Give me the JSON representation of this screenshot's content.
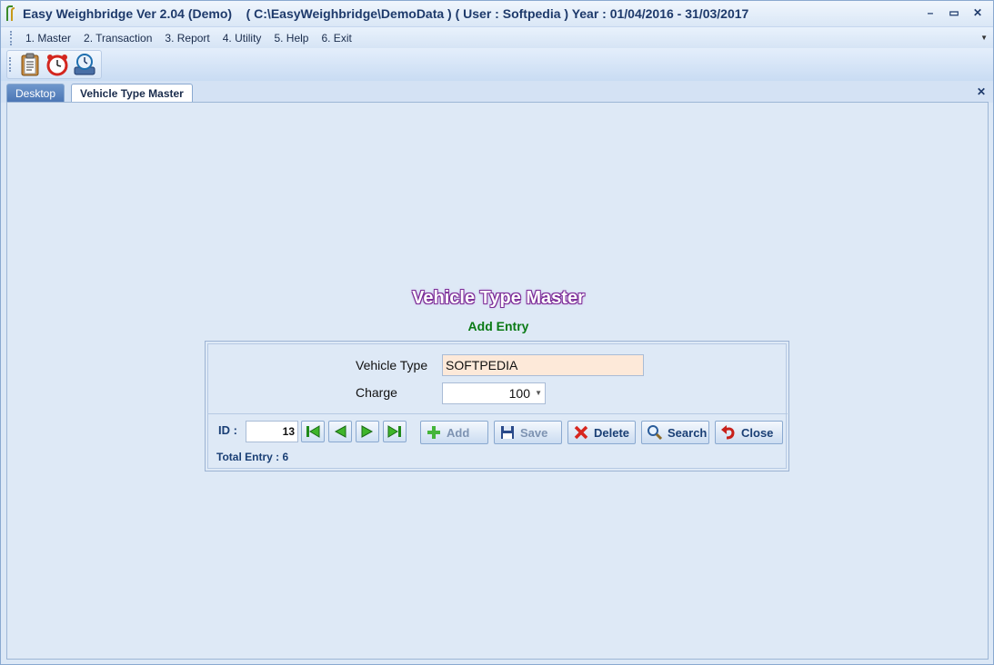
{
  "window": {
    "title": "Easy Weighbridge Ver 2.04 (Demo)    ( C:\\EasyWeighbridge\\DemoData ) ( User : Softpedia ) Year : 01/04/2016 - 31/03/2017",
    "controls": {
      "minimize": "–",
      "maximize": "▭",
      "close": "✕"
    }
  },
  "menu": {
    "items": [
      {
        "label": "1. Master"
      },
      {
        "label": "2. Transaction"
      },
      {
        "label": "3. Report"
      },
      {
        "label": "4. Utility"
      },
      {
        "label": "5. Help"
      },
      {
        "label": "6. Exit"
      }
    ]
  },
  "toolbar": {
    "icons": [
      "clipboard-icon",
      "alarm-clock-icon",
      "backup-history-icon"
    ]
  },
  "tabs": [
    {
      "label": "Desktop",
      "active": false
    },
    {
      "label": "Vehicle Type Master",
      "active": true
    }
  ],
  "form": {
    "title": "Vehicle Type Master",
    "subtitle": "Add Entry",
    "vehicle_type_label": "Vehicle Type",
    "vehicle_type_value": "SOFTPEDIA",
    "charge_label": "Charge",
    "charge_value": "100",
    "id_label": "ID :",
    "id_value": "13",
    "buttons": {
      "add": "Add",
      "save": "Save",
      "delete": "Delete",
      "search": "Search",
      "close": "Close"
    },
    "total_entry": "Total Entry : 6"
  },
  "colors": {
    "title_purple": "#7b2c97",
    "subtitle_green": "#0a7a15",
    "input_highlight": "#fde9d9",
    "label_blue": "#1a3f75"
  }
}
